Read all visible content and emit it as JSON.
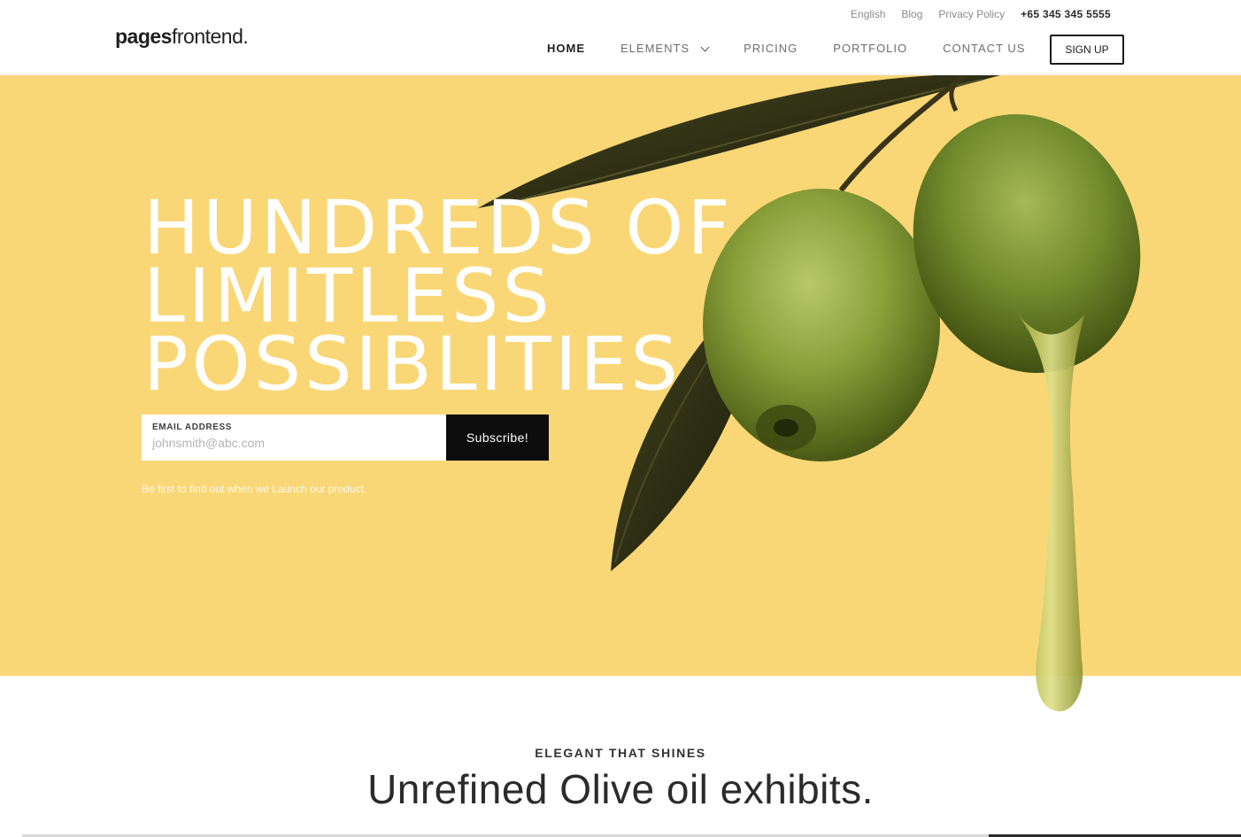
{
  "header": {
    "logo_bold": "pages",
    "logo_light": "frontend.",
    "topbar": {
      "language": "English",
      "blog": "Blog",
      "privacy": "Privacy Policy",
      "phone": "+65 345 345 5555"
    },
    "nav": {
      "home": "HOME",
      "elements": "ELEMENTS",
      "pricing": "PRICING",
      "portfolio": "PORTFOLIO",
      "contact": "CONTACT US"
    },
    "signup_label": "SIGN UP"
  },
  "hero": {
    "background": "#fad776",
    "headline": [
      "HUNDREDS OF",
      "LIMITLESS",
      "POSSIBLITIES"
    ],
    "subscribe": {
      "field_label": "EMAIL ADDRESS",
      "placeholder": "johnsmith@abc.com",
      "button_label": "Subscribe!"
    },
    "note": "Be first to find out when we Launch our product."
  },
  "section": {
    "eyebrow": "ELEGANT THAT SHINES",
    "title": "Unrefined Olive oil exhibits."
  }
}
